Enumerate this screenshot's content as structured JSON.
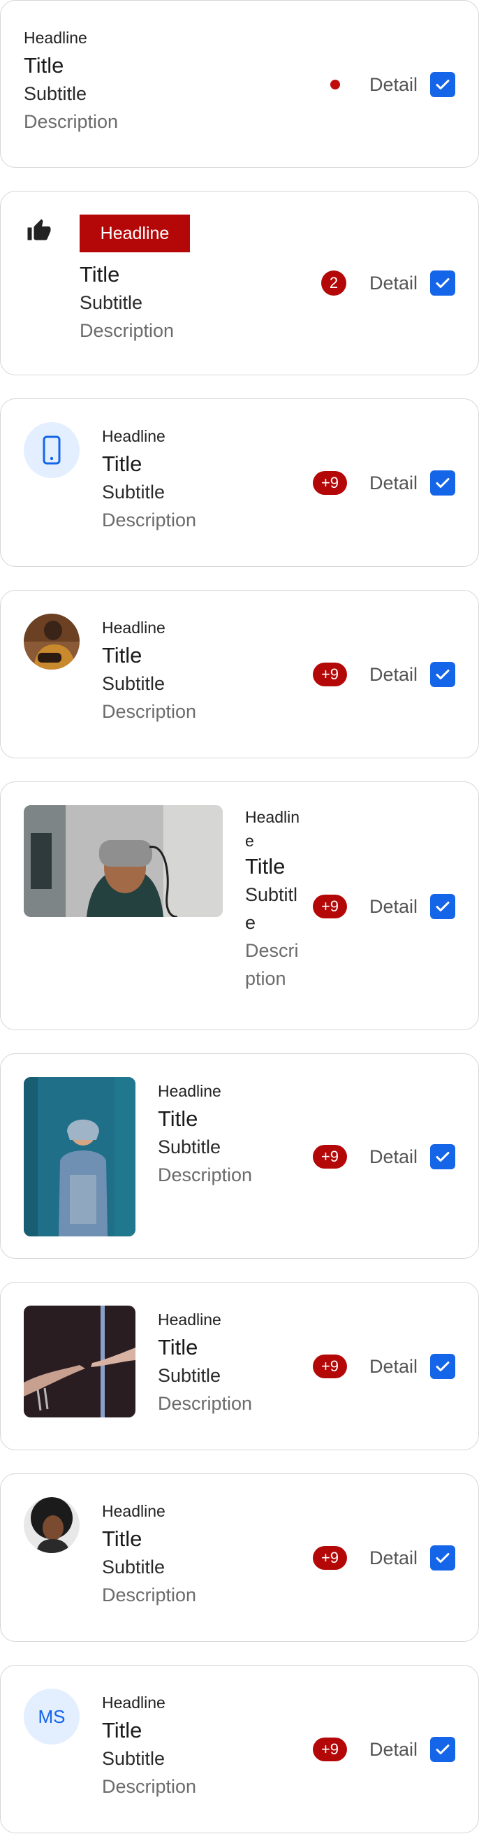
{
  "cards": [
    {
      "headline": "Headline",
      "title": "Title",
      "subtitle": "Subtitle",
      "description": "Description",
      "detail": "Detail"
    },
    {
      "headline": "Headline",
      "title": "Title",
      "subtitle": "Subtitle",
      "description": "Description",
      "badge": "2",
      "detail": "Detail"
    },
    {
      "headline": "Headline",
      "title": "Title",
      "subtitle": "Subtitle",
      "description": "Description",
      "badge": "+9",
      "detail": "Detail"
    },
    {
      "headline": "Headline",
      "title": "Title",
      "subtitle": "Subtitle",
      "description": "Description",
      "badge": "+9",
      "detail": "Detail"
    },
    {
      "headline": "Headline",
      "title": "Title",
      "subtitle": "Subtitle",
      "description": "Description",
      "badge": "+9",
      "detail": "Detail"
    },
    {
      "headline": "Headline",
      "title": "Title",
      "subtitle": "Subtitle",
      "description": "Description",
      "badge": "+9",
      "detail": "Detail"
    },
    {
      "headline": "Headline",
      "title": "Title",
      "subtitle": "Subtitle",
      "description": "Description",
      "badge": "+9",
      "detail": "Detail"
    },
    {
      "headline": "Headline",
      "title": "Title",
      "subtitle": "Subtitle",
      "description": "Description",
      "badge": "+9",
      "detail": "Detail"
    },
    {
      "headline": "Headline",
      "title": "Title",
      "subtitle": "Subtitle",
      "description": "Description",
      "badge": "+9",
      "detail": "Detail",
      "initials": "MS"
    }
  ],
  "colors": {
    "accent_blue": "#1565e8",
    "badge_red": "#b40808",
    "border": "#d6d6d6",
    "icon_bg": "#e3efff"
  },
  "icons": {
    "card1": "status-dot",
    "card2": "thumbs-up-icon",
    "card3": "mobile-phone-icon",
    "checkbox": "check-icon"
  }
}
